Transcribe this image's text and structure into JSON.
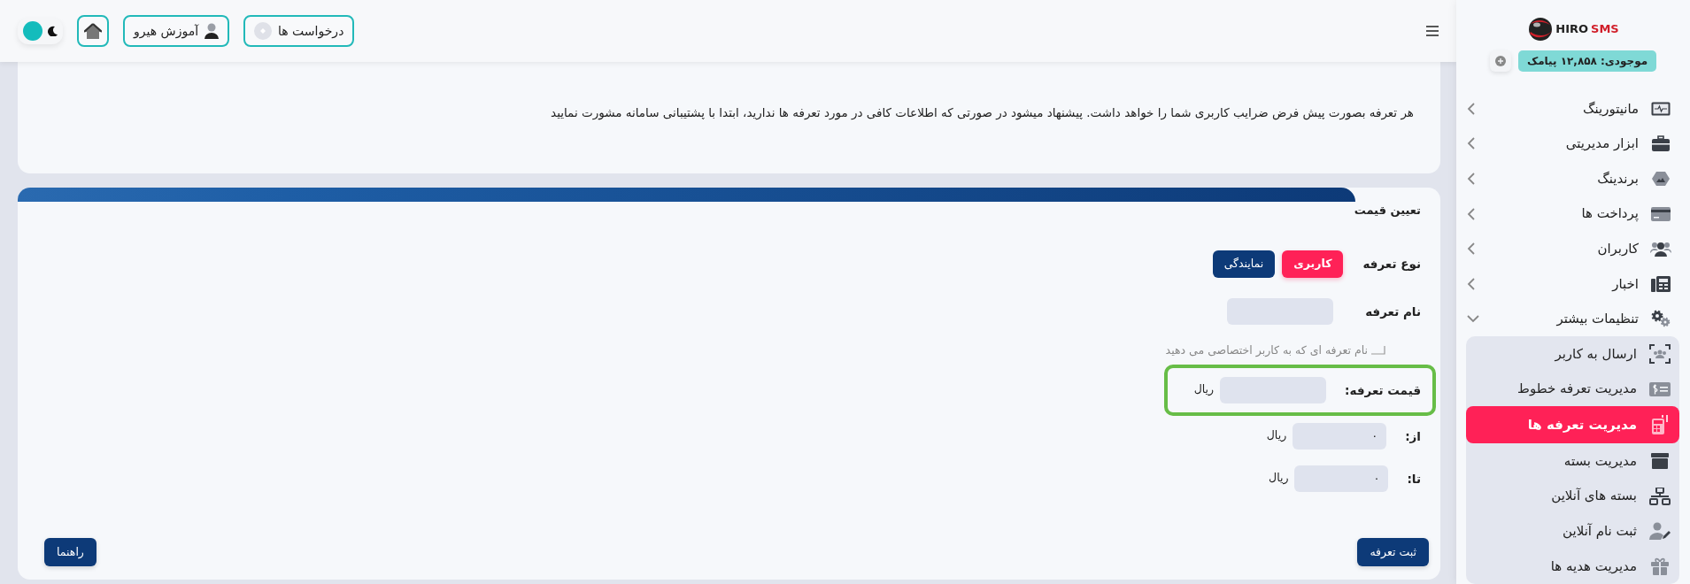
{
  "topbar": {
    "buttons": [
      {
        "kind": "requests",
        "label": "درخواست ها"
      },
      {
        "kind": "tutorial",
        "label": "آموزش هیرو"
      },
      {
        "kind": "home"
      }
    ],
    "dark_mode": false
  },
  "sidebar": {
    "logo": {
      "brand": "HIRO",
      "product": "SMS"
    },
    "balance": "موجودی: ۱۲,۸۵۸ پیامک",
    "items": [
      {
        "label": "مانیتورینگ",
        "expanded": false
      },
      {
        "label": "ابزار مدیریتی",
        "expanded": false
      },
      {
        "label": "برندینگ",
        "expanded": false
      },
      {
        "label": "پرداخت ها",
        "expanded": false
      },
      {
        "label": "کاربران",
        "expanded": false
      },
      {
        "label": "اخبار",
        "expanded": false
      },
      {
        "label": "تنظیمات بیشتر",
        "expanded": true,
        "children": [
          {
            "label": "ارسال به کاربر",
            "selected": false
          },
          {
            "label": "مدیریت تعرفه خطوط",
            "selected": false
          },
          {
            "label": "مدیریت تعرفه ها",
            "selected": true
          },
          {
            "label": "مدیریت بسته",
            "selected": false
          },
          {
            "label": "بسته های آنلاین",
            "selected": false
          },
          {
            "label": "ثبت نام آنلاین",
            "selected": false
          },
          {
            "label": "مدیریت هدیه ها",
            "selected": false
          }
        ]
      }
    ]
  },
  "notice": {
    "text": "هر تعرفه بصورت پیش فرض ضرایب کاربری شما را خواهد داشت. پیشنهاد میشود در صورتی که اطلاعات کافی در مورد تعرفه ها ندارید، ابتدا با پشتیبانی سامانه مشورت نمایید"
  },
  "pricing": {
    "title": "تعیین قیمت",
    "type_label": "نوع تعرفه",
    "type_options": [
      {
        "label": "کاربری",
        "selected": true
      },
      {
        "label": "نمایندگی",
        "selected": false
      }
    ],
    "name_label": "نام تعرفه",
    "name_hint": "نام تعرفه ای که به کاربر اختصاصی می دهید",
    "fields": [
      {
        "label": "قیمت تعرفه:",
        "unit": "ریال",
        "highlighted": true
      },
      {
        "label": "از:",
        "value": "۰",
        "unit": "ریال",
        "highlighted": false
      },
      {
        "label": "تا:",
        "value": "۰",
        "unit": "ریال",
        "highlighted": false
      }
    ],
    "buttons": [
      {
        "kind": "submit",
        "label": "ثبت تعرفه"
      },
      {
        "kind": "help",
        "label": "راهنما"
      }
    ]
  }
}
